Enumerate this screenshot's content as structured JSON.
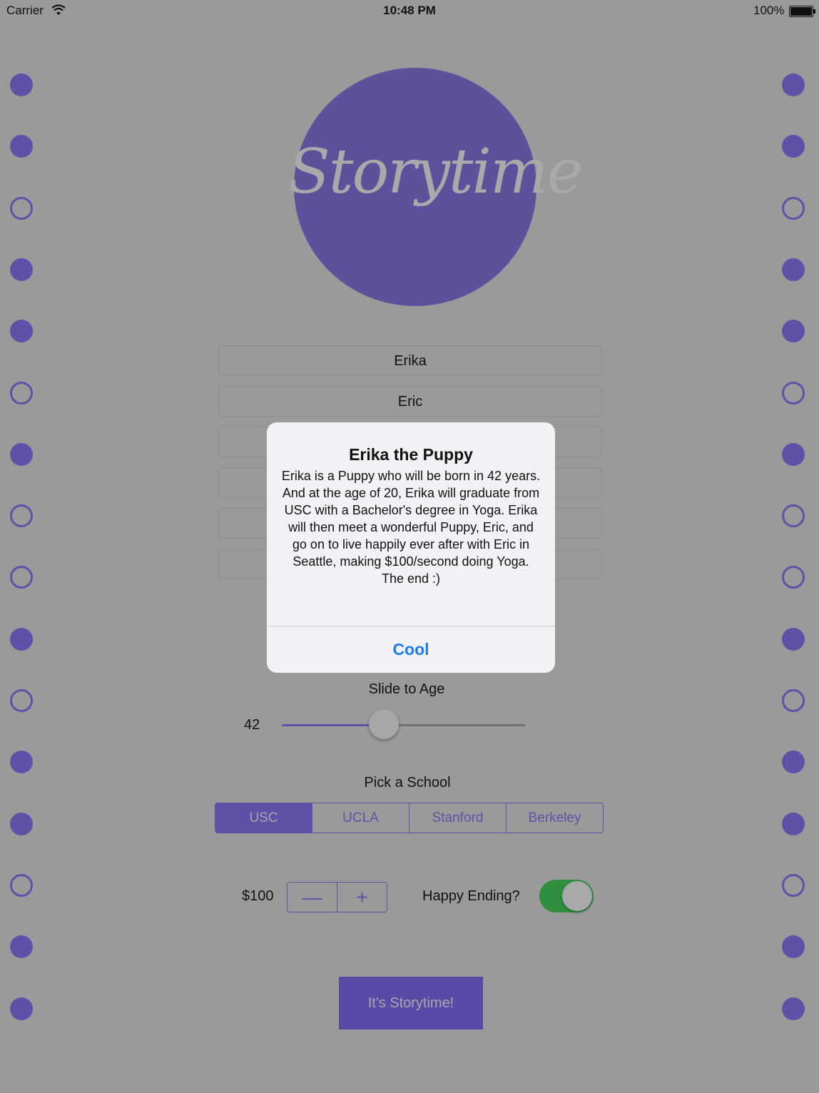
{
  "status_bar": {
    "carrier": "Carrier",
    "time": "10:48 PM",
    "battery": "100%"
  },
  "logo": {
    "text": "Storytime"
  },
  "fields": [
    {
      "value": "Erika"
    },
    {
      "value": "Eric"
    },
    {
      "value": ""
    },
    {
      "value": ""
    },
    {
      "value": ""
    },
    {
      "value": ""
    }
  ],
  "age_slider": {
    "label": "Slide to Age",
    "value": "42",
    "fill_fraction": 0.42
  },
  "school": {
    "label": "Pick a School",
    "options": [
      "USC",
      "UCLA",
      "Stanford",
      "Berkeley"
    ],
    "selected": "USC"
  },
  "money": {
    "value": "$100",
    "decrement": "—",
    "increment": "+"
  },
  "happy_ending": {
    "label": "Happy Ending?",
    "on": true
  },
  "action_button": "It's Storytime!",
  "alert": {
    "title": "Erika the Puppy",
    "message": "Erika is a Puppy who will be born in 42 years. And at the age of 20, Erika will graduate from USC with a Bachelor's degree in Yoga. Erika will then meet a wonderful Puppy, Eric, and go on to live happily ever after with Eric in Seattle, making $100/second doing Yoga. The end :)",
    "button": "Cool"
  },
  "colors": {
    "accent": "#5f51a8",
    "dim_background": "#9a9a9a",
    "alert_button": "#1a7cf2",
    "toggle_on": "#2f8f3f"
  },
  "binder_holes": [
    "filled",
    "filled",
    "open",
    "filled",
    "filled",
    "open",
    "filled",
    "open",
    "open",
    "filled",
    "open",
    "filled",
    "filled",
    "open",
    "filled",
    "filled"
  ]
}
